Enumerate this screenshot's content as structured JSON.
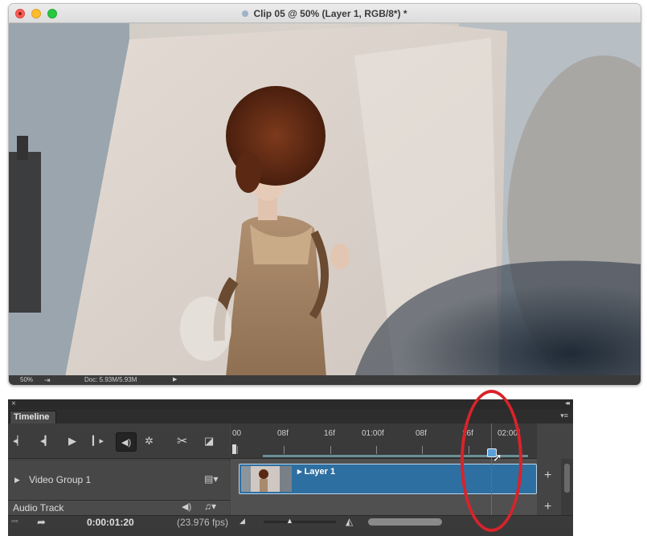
{
  "document": {
    "title": "Clip 05 @ 50% (Layer 1, RGB/8*) *",
    "status": {
      "zoom": "50%",
      "doc_size": "Doc: 5.93M/5.93M"
    }
  },
  "timeline": {
    "close_glyph": "×",
    "collapse_glyph": "◂◂",
    "tab_label": "Timeline",
    "menu_glyph": "▾≡",
    "controls": {
      "first_frame": "go-to-first-frame-icon",
      "prev_frame": "previous-frame-icon",
      "play": "play-icon",
      "next_frame": "next-frame-icon",
      "audio": "speaker-icon",
      "settings": "gear-icon",
      "split": "scissors-icon",
      "transition": "transition-icon"
    },
    "ruler_labels": [
      "00",
      "08f",
      "16f",
      "01:00f",
      "08f",
      "16f",
      "02:00f"
    ],
    "tracks": {
      "video_group": "Video Group 1",
      "audio_track": "Audio Track"
    },
    "clip": {
      "label": "Layer 1"
    },
    "bottom": {
      "timecode": "0:00:01:20",
      "fps": "(23.976 fps)"
    },
    "plus_glyph": "+"
  },
  "colors": {
    "clip_blue": "#2e6fa1",
    "playhead": "#c84a2c",
    "annotation_red": "#d8232a"
  }
}
